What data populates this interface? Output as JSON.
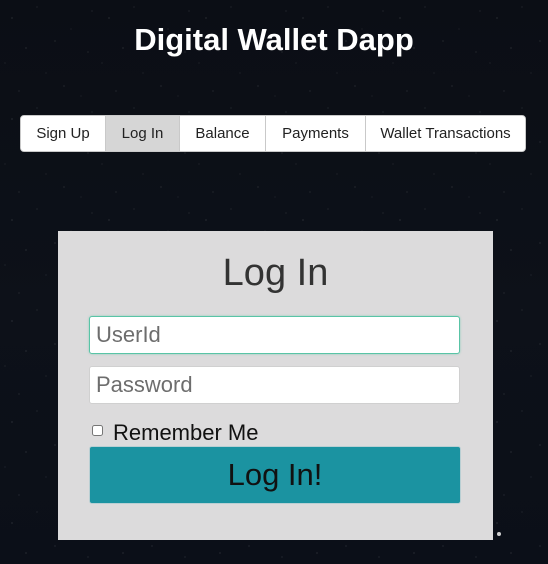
{
  "app": {
    "title": "Digital Wallet Dapp"
  },
  "nav": {
    "tabs": [
      {
        "label": "Sign Up",
        "active": false
      },
      {
        "label": "Log In",
        "active": true
      },
      {
        "label": "Balance",
        "active": false
      },
      {
        "label": "Payments",
        "active": false
      },
      {
        "label": "Wallet Transactions",
        "active": false
      }
    ]
  },
  "login": {
    "heading": "Log In",
    "userid": {
      "placeholder": "UserId",
      "value": "",
      "focused": true
    },
    "password": {
      "placeholder": "Password",
      "value": ""
    },
    "remember": {
      "label": "Remember Me",
      "checked": false
    },
    "submit_label": "Log In!"
  },
  "colors": {
    "background": "#0b0e15",
    "panel": "#dcdbdc",
    "button": "#1b93a1",
    "active_tab": "#d6d6d6",
    "focus_border": "#59c4a6"
  }
}
